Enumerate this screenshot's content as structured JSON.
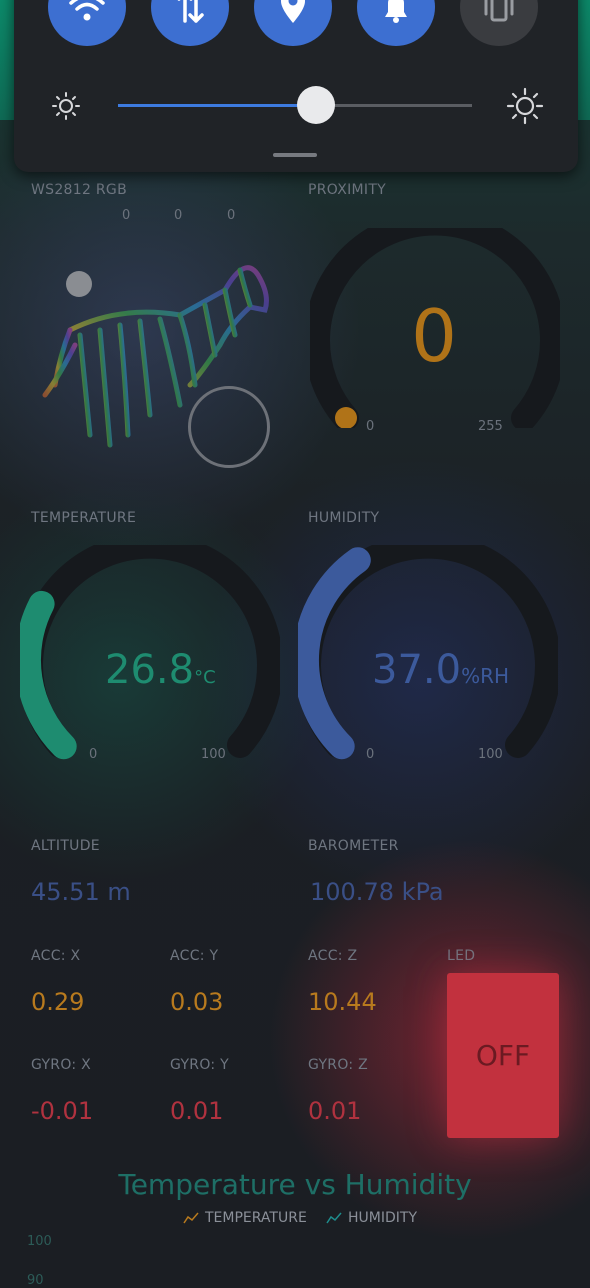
{
  "quick_settings": {
    "tiles": [
      {
        "name": "wifi-icon",
        "active": true
      },
      {
        "name": "mobile-data-icon",
        "active": true
      },
      {
        "name": "location-icon",
        "active": true
      },
      {
        "name": "bell-icon",
        "active": true
      },
      {
        "name": "vibrate-icon",
        "active": false
      }
    ],
    "brightness_level": 0.56
  },
  "widgets": {
    "rgb": {
      "label": "WS2812 RGB",
      "r": "0",
      "g": "0",
      "b": "0"
    },
    "proximity": {
      "label": "PROXIMITY",
      "value": "0",
      "min": "0",
      "max": "255",
      "color": "#c9821b"
    },
    "temperature": {
      "label": "TEMPERATURE",
      "value": "26.8",
      "unit": "°C",
      "min": "0",
      "max": "100",
      "fraction": 0.268,
      "color": "#1e8c70"
    },
    "humidity": {
      "label": "HUMIDITY",
      "value": "37.0",
      "unit": "%RH",
      "min": "0",
      "max": "100",
      "fraction": 0.37,
      "color": "#3c5a9c"
    },
    "altitude": {
      "label": "ALTITUDE",
      "value": "45.51 m",
      "color": "#3a4f86"
    },
    "barometer": {
      "label": "BAROMETER",
      "value": "100.78 kPa",
      "color": "#3a4f86"
    },
    "acc_x": {
      "label": "ACC: X",
      "value": "0.29",
      "color": "#b87a1e"
    },
    "acc_y": {
      "label": "ACC: Y",
      "value": "0.03",
      "color": "#b87a1e"
    },
    "acc_z": {
      "label": "ACC: Z",
      "value": "10.44",
      "color": "#b87a1e"
    },
    "gyro_x": {
      "label": "GYRO: X",
      "value": "-0.01",
      "color": "#b0323f"
    },
    "gyro_y": {
      "label": "GYRO: Y",
      "value": "0.01",
      "color": "#b0323f"
    },
    "gyro_z": {
      "label": "GYRO: Z",
      "value": "0.01",
      "color": "#b0323f"
    },
    "led": {
      "label": "LED",
      "state": "OFF",
      "color": "#c2313e"
    }
  },
  "chart": {
    "title": "Temperature vs Humidity",
    "legend": [
      {
        "name": "TEMPERATURE",
        "color": "#b87a1e"
      },
      {
        "name": "HUMIDITY",
        "color": "#1e8c8c"
      }
    ],
    "y_ticks": [
      "100",
      "90"
    ]
  }
}
